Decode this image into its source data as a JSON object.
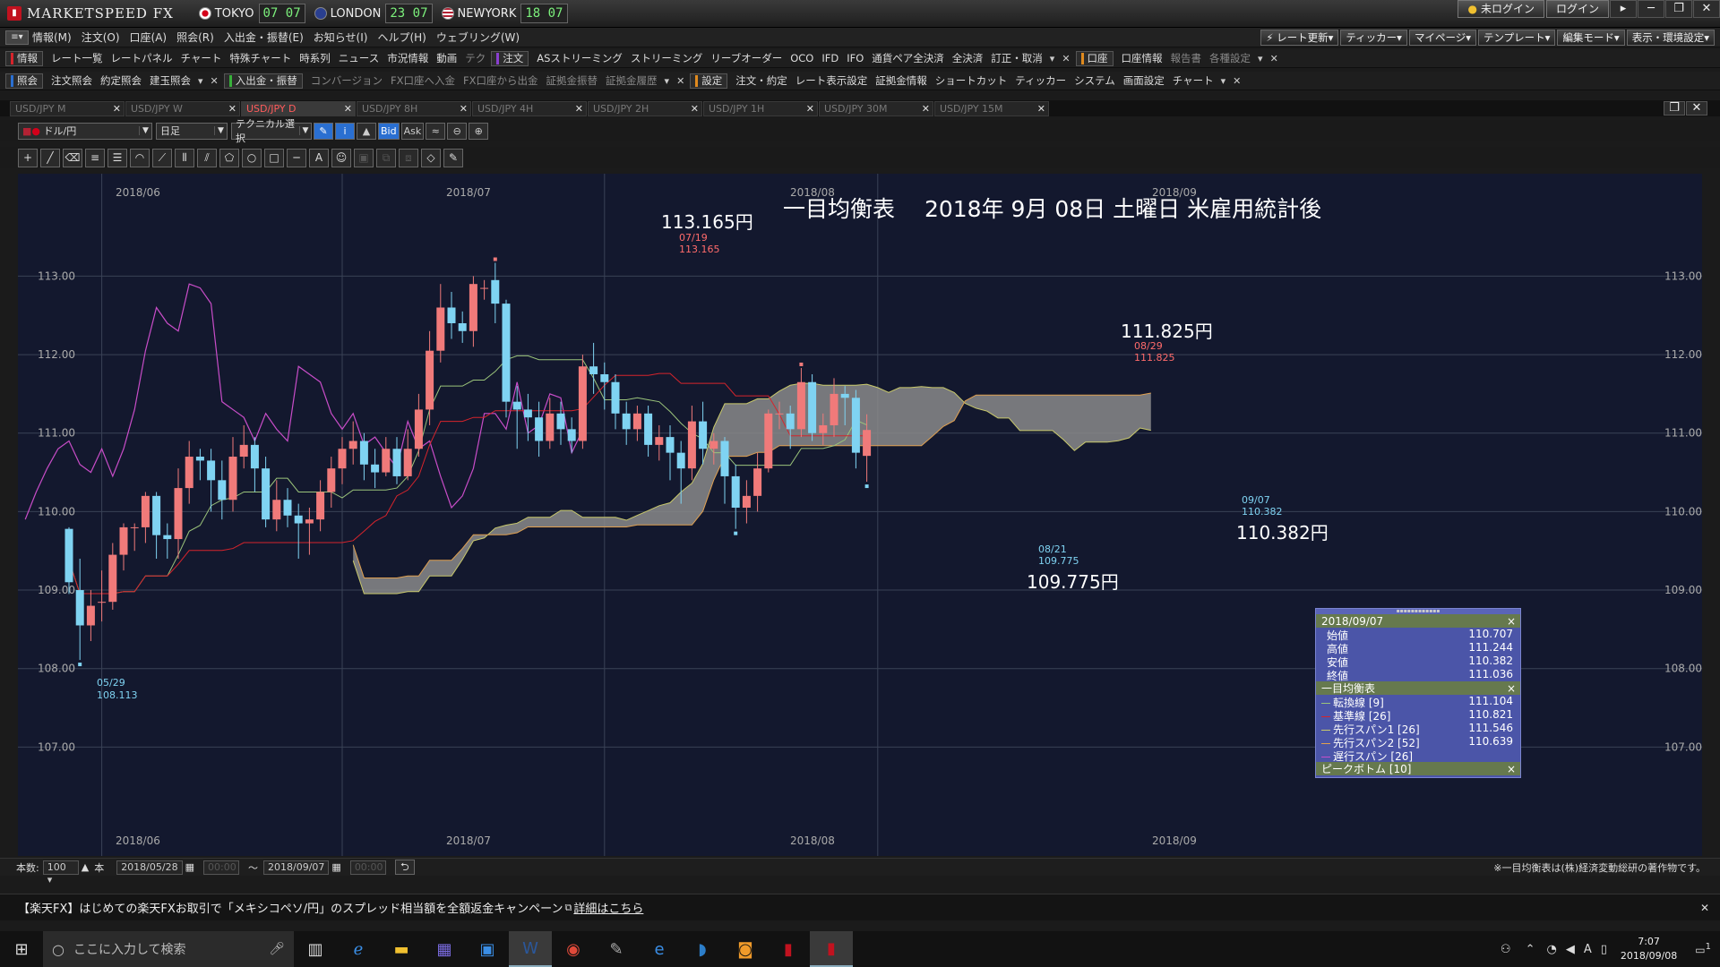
{
  "app": {
    "title": "MARKETSPEED FX"
  },
  "markets": [
    {
      "name": "TOKYO",
      "time": "07 07",
      "flag_color": "#d4001a"
    },
    {
      "name": "LONDON",
      "time": "23 07",
      "flag_color": "#2a3f90"
    },
    {
      "name": "NEWYORK",
      "time": "18 07",
      "flag_color": "#b22234"
    }
  ],
  "titlebar": {
    "login_status": "未ログイン",
    "login_button": "ログイン",
    "win_buttons": [
      "▸",
      "─",
      "❐",
      "✕"
    ]
  },
  "menu": {
    "items": [
      "情報(M)",
      "注文(O)",
      "口座(A)",
      "照会(R)",
      "入出金・振替(E)",
      "お知らせ(I)",
      "ヘルプ(H)",
      "ウェブリング(W)"
    ],
    "right_buttons": [
      "⚡ レート更新▾",
      "ティッカー▾",
      "マイページ▾",
      "テンプレート▾",
      "編集モード▾",
      "表示・環境設定▾"
    ]
  },
  "toolbar1": {
    "group1_label": "情報",
    "group1_items": [
      "レート一覧",
      "レートパネル",
      "チャート",
      "特殊チャート",
      "時系列",
      "ニュース",
      "市況情報",
      "動画",
      "テク"
    ],
    "group2_label": "注文",
    "group2_items": [
      "ASストリーミング",
      "ストリーミング",
      "リーブオーダー",
      "OCO",
      "IFD",
      "IFO",
      "通貨ペア全決済",
      "全決済",
      "訂正・取消"
    ],
    "group3_label": "口座",
    "group3_items": [
      "口座情報",
      "報告書",
      "各種設定"
    ]
  },
  "toolbar2": {
    "group1_label": "照会",
    "group1_items": [
      "注文照会",
      "約定照会",
      "建玉照会"
    ],
    "group2_label": "入出金・振替",
    "group2_items": [
      "コンバージョン",
      "FX口座へ入金",
      "FX口座から出金",
      "証拠金振替",
      "証拠金履歴"
    ],
    "group3_label": "設定",
    "group3_items": [
      "注文・約定",
      "レート表示設定",
      "証拠金情報",
      "ショートカット",
      "ティッカー",
      "システム",
      "画面設定",
      "チャート"
    ]
  },
  "tabs": [
    {
      "label": "USD/JPY M",
      "active": false
    },
    {
      "label": "USD/JPY W",
      "active": false
    },
    {
      "label": "USD/JPY D",
      "active": true
    },
    {
      "label": "USD/JPY 8H",
      "active": false
    },
    {
      "label": "USD/JPY 4H",
      "active": false
    },
    {
      "label": "USD/JPY 2H",
      "active": false
    },
    {
      "label": "USD/JPY 1H",
      "active": false
    },
    {
      "label": "USD/JPY 30M",
      "active": false
    },
    {
      "label": "USD/JPY 15M",
      "active": false
    }
  ],
  "controls": {
    "pair": "ドル/円",
    "timeframe": "日足",
    "technical": "テクニカル選択",
    "bid": "Bid",
    "ask": "Ask"
  },
  "chart": {
    "title": "一目均衡表　 2018年 9月 08日 土曜日 米雇用統計後",
    "annotations": {
      "high1_big": "113.165円",
      "high1_date": "07/19",
      "high1_val": "113.165",
      "high2_big": "111.825円",
      "high2_date": "08/29",
      "high2_val": "111.825",
      "low1_big": "109.775円",
      "low1_date": "08/21",
      "low1_val": "109.775",
      "low2_big": "110.382円",
      "low2_date": "09/07",
      "low2_val": "110.382",
      "low0_date": "05/29",
      "low0_val": "108.113"
    },
    "colors": {
      "up": "#f07a7a",
      "down": "#7fd3f2",
      "tenkan": "#9bc47b",
      "kijun": "#d6242c",
      "span1": "#c9c96b",
      "span2": "#e0a050",
      "chikou": "#c84dc8",
      "cloud": "#8a8a8a"
    }
  },
  "chart_data": {
    "type": "candlestick",
    "pair": "USD/JPY",
    "timeframe": "D",
    "y_ticks": [
      "107.00",
      "108.00",
      "109.00",
      "110.00",
      "111.00",
      "112.00",
      "113.00"
    ],
    "ylim": [
      106.0,
      114.1
    ],
    "x_ticks": [
      "2018/06",
      "2018/07",
      "2018/08",
      "2018/09"
    ],
    "candles": [
      [
        109.78,
        109.1,
        109.8,
        108.95
      ],
      [
        109.0,
        108.55,
        109.4,
        108.11
      ],
      [
        108.55,
        108.8,
        109.0,
        108.35
      ],
      [
        108.85,
        108.85,
        109.25,
        108.6
      ],
      [
        108.85,
        109.45,
        109.6,
        108.75
      ],
      [
        109.45,
        109.8,
        109.85,
        109.25
      ],
      [
        109.8,
        109.8,
        109.85,
        109.5
      ],
      [
        109.8,
        110.2,
        110.25,
        109.6
      ],
      [
        110.2,
        109.7,
        110.25,
        109.4
      ],
      [
        109.7,
        109.65,
        109.85,
        109.4
      ],
      [
        109.65,
        110.3,
        110.55,
        109.4
      ],
      [
        110.3,
        110.7,
        110.9,
        110.1
      ],
      [
        110.7,
        110.65,
        110.8,
        110.4
      ],
      [
        110.65,
        110.4,
        110.8,
        110.0
      ],
      [
        110.4,
        110.15,
        110.65,
        109.9
      ],
      [
        110.15,
        110.7,
        110.95,
        110.0
      ],
      [
        110.7,
        110.85,
        111.1,
        110.55
      ],
      [
        110.85,
        110.55,
        110.95,
        110.25
      ],
      [
        110.55,
        109.9,
        110.7,
        109.8
      ],
      [
        109.9,
        110.15,
        110.4,
        109.75
      ],
      [
        110.15,
        109.95,
        110.3,
        109.8
      ],
      [
        109.95,
        109.85,
        110.1,
        109.4
      ],
      [
        109.85,
        109.9,
        110.05,
        109.45
      ],
      [
        109.9,
        110.25,
        110.4,
        109.75
      ],
      [
        110.25,
        110.55,
        110.7,
        110.05
      ],
      [
        110.55,
        110.8,
        110.95,
        110.35
      ],
      [
        110.8,
        110.9,
        111.15,
        110.6
      ],
      [
        110.9,
        110.6,
        111.0,
        110.4
      ],
      [
        110.6,
        110.5,
        110.8,
        110.3
      ],
      [
        110.5,
        110.8,
        110.95,
        110.45
      ],
      [
        110.8,
        110.45,
        110.95,
        110.35
      ],
      [
        110.45,
        110.8,
        111.05,
        110.4
      ],
      [
        110.8,
        111.3,
        111.5,
        110.7
      ],
      [
        111.3,
        112.05,
        112.3,
        111.1
      ],
      [
        112.05,
        112.6,
        112.9,
        111.9
      ],
      [
        112.6,
        112.4,
        112.8,
        112.2
      ],
      [
        112.4,
        112.3,
        112.55,
        112.15
      ],
      [
        112.3,
        112.9,
        113.0,
        112.1
      ],
      [
        112.85,
        112.85,
        112.95,
        112.7
      ],
      [
        112.95,
        112.65,
        113.17,
        112.4
      ],
      [
        112.65,
        111.4,
        112.7,
        111.2
      ],
      [
        111.4,
        111.3,
        111.6,
        110.8
      ],
      [
        111.3,
        111.2,
        111.5,
        110.9
      ],
      [
        111.2,
        110.9,
        111.4,
        110.7
      ],
      [
        110.9,
        111.25,
        111.45,
        110.8
      ],
      [
        111.25,
        111.05,
        111.4,
        110.85
      ],
      [
        111.05,
        110.9,
        111.2,
        110.75
      ],
      [
        110.9,
        111.85,
        112.0,
        110.8
      ],
      [
        111.85,
        111.75,
        112.15,
        111.5
      ],
      [
        111.75,
        111.65,
        111.9,
        111.3
      ],
      [
        111.65,
        111.25,
        111.75,
        111.05
      ],
      [
        111.25,
        111.05,
        111.4,
        110.85
      ],
      [
        111.05,
        111.25,
        111.35,
        110.9
      ],
      [
        111.25,
        110.85,
        111.35,
        110.7
      ],
      [
        110.85,
        110.95,
        111.1,
        110.65
      ],
      [
        110.95,
        110.75,
        111.1,
        110.4
      ],
      [
        110.75,
        110.55,
        110.9,
        110.1
      ],
      [
        110.55,
        111.15,
        111.35,
        110.4
      ],
      [
        111.15,
        110.8,
        111.4,
        110.6
      ],
      [
        110.8,
        110.9,
        111.0,
        110.6
      ],
      [
        110.9,
        110.45,
        110.95,
        110.1
      ],
      [
        110.45,
        110.05,
        110.6,
        109.78
      ],
      [
        110.05,
        110.2,
        110.4,
        109.85
      ],
      [
        110.2,
        110.55,
        110.75,
        110.0
      ],
      [
        110.55,
        111.25,
        111.3,
        110.5
      ],
      [
        111.25,
        111.25,
        111.4,
        111.05
      ],
      [
        111.25,
        111.05,
        111.35,
        110.8
      ],
      [
        111.05,
        111.65,
        111.83,
        110.95
      ],
      [
        111.65,
        111.0,
        111.75,
        110.9
      ],
      [
        111.0,
        111.1,
        111.25,
        110.85
      ],
      [
        111.1,
        111.5,
        111.7,
        110.95
      ],
      [
        111.5,
        111.45,
        111.6,
        111.1
      ],
      [
        111.45,
        110.75,
        111.55,
        110.55
      ],
      [
        110.71,
        111.04,
        111.24,
        110.38
      ]
    ],
    "ichimoku": {
      "tenkan_period": 9,
      "kijun_period": 26,
      "span1_period": 26,
      "span2_period": 52,
      "chikou_period": 26
    }
  },
  "data_window": {
    "date": "2018/09/07",
    "ohlc": [
      {
        "label": "始値",
        "value": "110.707"
      },
      {
        "label": "高値",
        "value": "111.244"
      },
      {
        "label": "安値",
        "value": "110.382"
      },
      {
        "label": "終値",
        "value": "111.036"
      }
    ],
    "ichimoku_title": "一目均衡表",
    "ichimoku": [
      {
        "label": "転換線 [9]",
        "value": "111.104",
        "color": "#9bc47b"
      },
      {
        "label": "基準線 [26]",
        "value": "110.821",
        "color": "#d6242c"
      },
      {
        "label": "先行スパン1 [26]",
        "value": "111.546",
        "color": "#c9c96b"
      },
      {
        "label": "先行スパン2 [52]",
        "value": "110.639",
        "color": "#e0a050"
      },
      {
        "label": "遅行スパン [26]",
        "value": "",
        "color": "#c84dc8"
      }
    ],
    "peak_title": "ピークボトム [10]"
  },
  "bottom": {
    "count_label": "本数:",
    "count_value": "100",
    "unit": "本",
    "date_from": "2018/05/28",
    "date_to": "2018/09/07",
    "tilde": "〜",
    "time_placeholder": "00:00",
    "copyright": "※一目均衡表は(株)経済変動総研の著作物です。"
  },
  "news": {
    "text": "【楽天FX】はじめての楽天FXお取引で「メキシコペソ/円」のスプレッド相当額を全額返金キャンペーン",
    "link": "詳細はこちら"
  },
  "taskbar": {
    "search_placeholder": "ここに入力して検索",
    "time": "7:07",
    "date": "2018/09/08",
    "ime": "A",
    "notify_count": "1"
  }
}
